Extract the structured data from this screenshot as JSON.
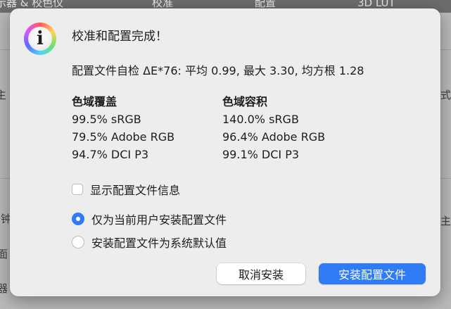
{
  "background": {
    "toolbar_fragments": [
      "示器 & 校色仪",
      "校准",
      "配置",
      "3D LUT"
    ],
    "side_fragments": [
      "主",
      "式",
      "分钟",
      "主題",
      "面",
      "器"
    ]
  },
  "dialog": {
    "title": "校准和配置完成！",
    "summary": "配置文件自检 ΔE*76: 平均 0.99, 最大 3.30, 均方根 1.28",
    "gamut_coverage": {
      "heading": "色域覆盖",
      "items": [
        "99.5% sRGB",
        "79.5% Adobe RGB",
        "94.7% DCI P3"
      ]
    },
    "gamut_volume": {
      "heading": "色域容积",
      "items": [
        "140.0% sRGB",
        "96.4% Adobe RGB",
        "99.1% DCI P3"
      ]
    },
    "show_profile_info": {
      "label": "显示配置文件信息",
      "checked": false
    },
    "install_options": [
      {
        "label": "仅为当前用户安装配置文件",
        "selected": true
      },
      {
        "label": "安装配置文件为系统默认值",
        "selected": false
      }
    ],
    "buttons": {
      "cancel": "取消安装",
      "install": "安装配置文件"
    },
    "icon": "info-icon",
    "colors": {
      "accent": "#2f7cf6",
      "dialog_bg": "#ededed"
    }
  }
}
